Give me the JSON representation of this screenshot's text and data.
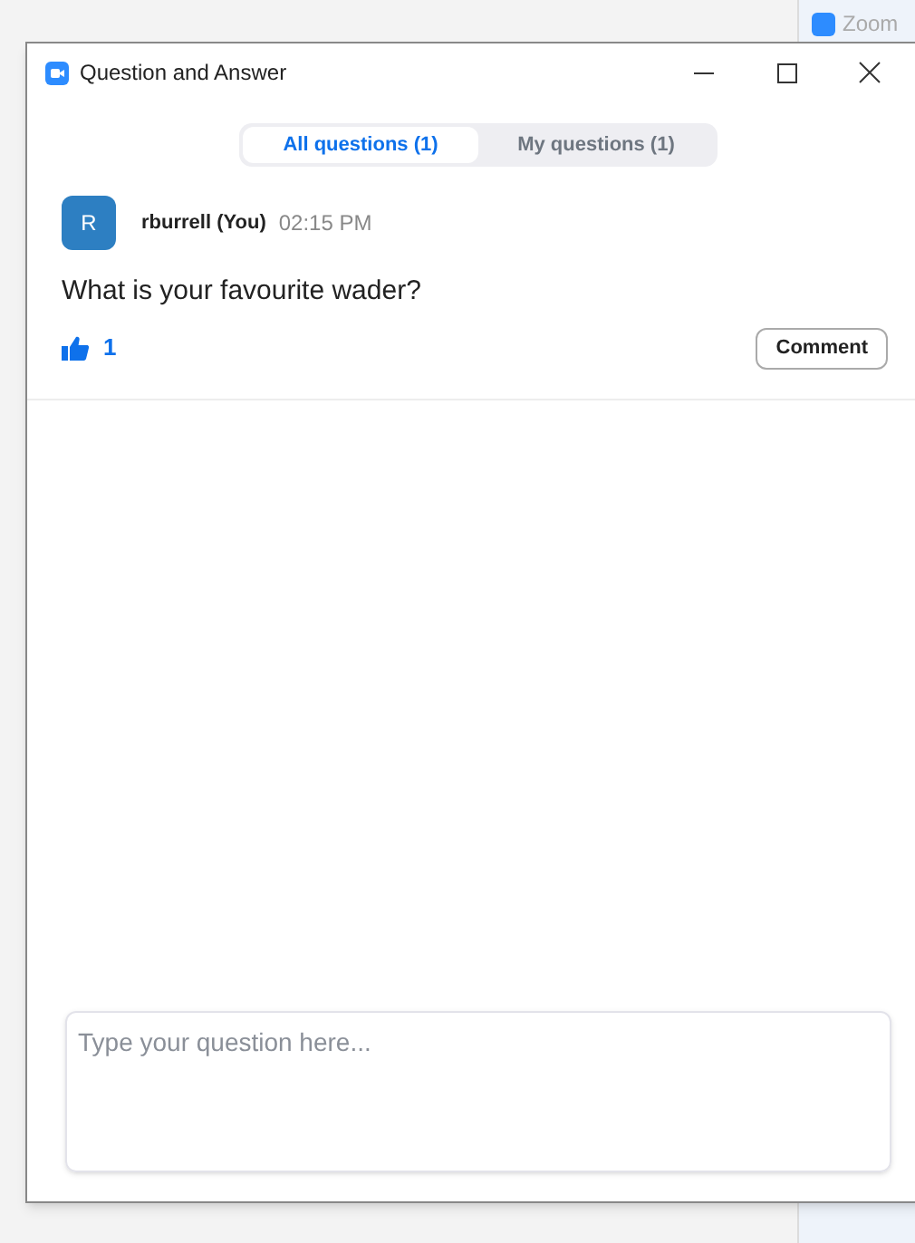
{
  "background": {
    "app_title": "Zoom"
  },
  "window": {
    "title": "Question and Answer"
  },
  "tabs": [
    {
      "label": "All questions (1)",
      "selected": true
    },
    {
      "label": "My questions (1)",
      "selected": false
    }
  ],
  "questions": [
    {
      "avatar_letter": "R",
      "author": "rburrell (You)",
      "time": "02:15 PM",
      "text": "What is your favourite wader?",
      "likes": "1",
      "liked": true,
      "comment_button": "Comment"
    }
  ],
  "input": {
    "placeholder": "Type your question here..."
  }
}
